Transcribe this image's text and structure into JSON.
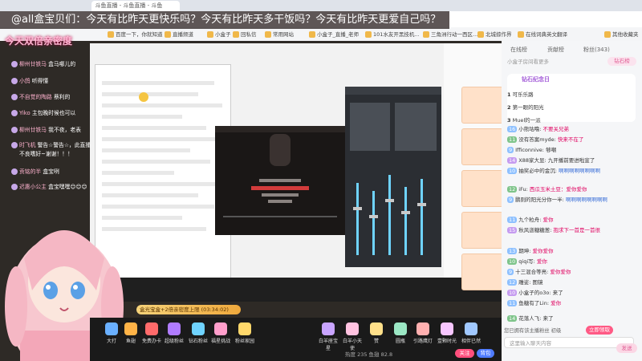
{
  "browser": {
    "tab_title": "斗鱼直播 - 斗鱼直播 - 斗鱼",
    "bookmarks": [
      "百度一下，你就知道",
      "直播频道",
      "小盒子",
      "回私信",
      "常用网站",
      "小盒子_直播_老师",
      "101水友开黑技机...",
      "三角洲行动一西区...",
      "北城掠作界",
      "在线词典英文翻译",
      "其他收藏夹"
    ]
  },
  "announcement": "@all盒宝贝们：今天有比昨天更快乐吗？今天有比昨天多干饭吗？今天有比昨天更爱自己吗？",
  "stream": {
    "title": "今天双倍亲密度",
    "danmaku": [
      {
        "user": "柳州廿铁马",
        "text": "盒马哪儿的"
      },
      {
        "user": "小鸽",
        "text": "听得懂"
      },
      {
        "user": "不自觉的陶路",
        "text": "蔡利的"
      },
      {
        "user": "Yiko",
        "text": "主包晚时候也可以"
      },
      {
        "user": "柳州廿铁马",
        "text": "我不夜，老表"
      },
      {
        "user": "时飞机",
        "text": "警告☆警告☆，此直播"
      },
      {
        "user": "",
        "text": "不良嗜好~谢谢！！！"
      },
      {
        "user": "贡铭的半",
        "text": "盒宝咧"
      },
      {
        "user": "迟惠小公主",
        "text": "盒宝嘿嘿😊😊😊"
      }
    ],
    "donation_bar": "盒光宝盒+2倍亲密度上限 (03:34:02)",
    "gifts": [
      "大打",
      "鱼翅",
      "免费办卡",
      "超级粉丝",
      "钻石粉丝",
      "福星挑战",
      "粉丝家园",
      "白羊座宝星",
      "白羊小天使",
      "赞",
      "圆瓶",
      "引路鹰灯",
      "壹颗时光",
      "相伴已然"
    ],
    "bottom_stats": "热度 235  鱼翅 82.8",
    "follow_label": "关注",
    "pack_label": "背包"
  },
  "panel": {
    "tabs": [
      "在线榜",
      "贡献榜",
      "粉丝(343)"
    ],
    "notice_line": "小盒子房间看更多",
    "search_label": "贡献榜",
    "rank_label": "钻石榜",
    "badge_title": "钻石纪念日",
    "ranks": [
      {
        "n": "1",
        "name": "可乐乐路"
      },
      {
        "n": "2",
        "name": "第一眼的阳光"
      },
      {
        "n": "3",
        "name": "Muel的一派"
      }
    ],
    "chats": [
      {
        "lv": "16",
        "name": "小熊咕噜",
        "text": "不要关兄弟"
      },
      {
        "lv": "11",
        "name": "没有答案myde",
        "text": "快来不在了"
      },
      {
        "lv": "9",
        "name": "Ifficonnive",
        "text": "够嘲"
      },
      {
        "lv": "14",
        "name": "X88家大显",
        "text": "九开播前要进啦宣了"
      },
      {
        "lv": "10",
        "name": "抽奖必中的金沉",
        "text": "啊啊啊啊啊啊啊啊"
      },
      {
        "lv": "12",
        "name": "iFu",
        "text": "西瓜玉米土豆：爱你爱你"
      },
      {
        "lv": "9",
        "name": "鹏则的阳光分你一半",
        "text": "啊啊啊啊啊啊啊啊"
      },
      {
        "lv": "11",
        "name": "九个粒舟",
        "text": "爱你"
      },
      {
        "lv": "15",
        "name": "秋风逝糖糖葱",
        "text": "抱求下一首是一首很"
      },
      {
        "lv": "13",
        "name": "期坤",
        "text": "爱你爱你"
      },
      {
        "lv": "10",
        "name": "qiqi写",
        "text": "爱你"
      },
      {
        "lv": "9",
        "name": "十三混合等亮",
        "text": "爱你爱你"
      },
      {
        "lv": "12",
        "name": "雕娑",
        "text": "图镜"
      },
      {
        "lv": "10",
        "name": "小盒子的o3o",
        "text": "来了"
      },
      {
        "lv": "11",
        "name": "鱼糖有了Lin",
        "text": "爱你"
      },
      {
        "lv": "14",
        "name": "花落人飞",
        "text": "来了"
      }
    ],
    "follow_prompt": "您已拥有该主播粉丝 初级",
    "follow_button": "立即领取",
    "input_placeholder": "这里输入聊天内容",
    "send_label": "发送"
  }
}
